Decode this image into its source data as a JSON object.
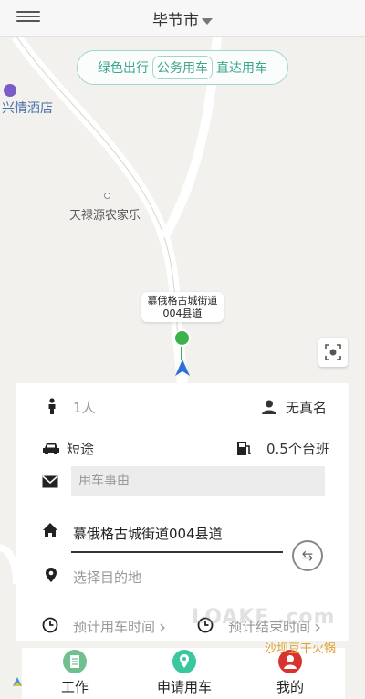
{
  "header": {
    "city": "毕节市"
  },
  "modes": [
    "绿色出行",
    "公务用车",
    "直达用车"
  ],
  "active_mode_index": 1,
  "map": {
    "pois": {
      "hotel": "兴情酒店",
      "farm": "天禄源农家乐"
    },
    "location_label_line1": "慕俄格古城街道",
    "location_label_line2": "004县道"
  },
  "form": {
    "passengers": "1人",
    "no_real_name": "无真名",
    "trip_type": "短途",
    "fuel": "0.5个台班",
    "reason_placeholder": "用车事由",
    "origin": "慕俄格古城街道004县道",
    "destination_placeholder": "选择目的地",
    "start_time_placeholder": "预计用车时间",
    "end_time_placeholder": "预计结束时间"
  },
  "tabs": [
    {
      "label": "工作",
      "color": "#6fbf8f"
    },
    {
      "label": "申请用车",
      "color": "#3ac7a0"
    },
    {
      "label": "我的",
      "color": "#d9332f"
    }
  ],
  "overlay": {
    "watermark": "LOAKE .com",
    "corner_text": "沙坝豆干火锅"
  },
  "colors": {
    "accent": "#3aa88e",
    "pin": "#3bb34a",
    "nav": "#2e6fd8"
  }
}
